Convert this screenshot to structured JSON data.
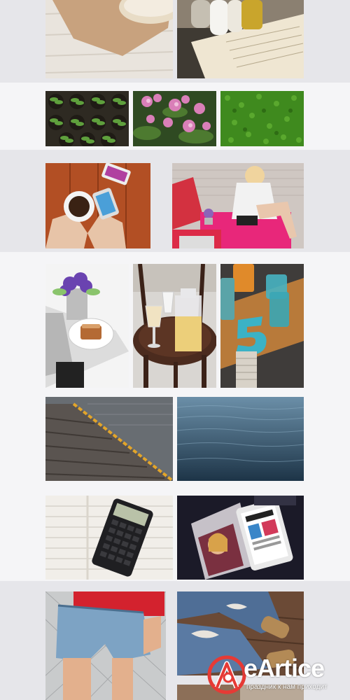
{
  "colors": {
    "page_background": "#ececef",
    "band_light": "#f5f5f7",
    "band_dark": "#e6e6ea",
    "watermark_red": "#e63a35"
  },
  "gallery": {
    "rows": [
      {
        "name": "row-1",
        "photos": [
          {
            "icon": "bread-on-paper-photo"
          },
          {
            "icon": "table-salt-pepper-menu-photo"
          }
        ]
      },
      {
        "name": "row-2",
        "photos": [
          {
            "icon": "seedlings-photo"
          },
          {
            "icon": "pink-flowers-photo"
          },
          {
            "icon": "green-grass-photo"
          }
        ]
      },
      {
        "name": "row-3",
        "photos": [
          {
            "icon": "coffee-cup-hands-photo"
          },
          {
            "icon": "woman-reading-sofa-photo"
          }
        ]
      },
      {
        "name": "row-4",
        "photos": [
          {
            "icon": "violets-cake-magazine-photo"
          },
          {
            "icon": "chair-glasses-jar-photo"
          },
          {
            "icon": "number-five-jars-photo"
          }
        ]
      },
      {
        "name": "row-5",
        "photos": [
          {
            "icon": "pier-water-photo"
          },
          {
            "icon": "blue-water-photo"
          }
        ]
      },
      {
        "name": "row-6",
        "photos": [
          {
            "icon": "calculator-paper-photo"
          },
          {
            "icon": "tablet-magazine-photo"
          }
        ]
      },
      {
        "name": "row-7",
        "photos": [
          {
            "icon": "denim-shorts-photo"
          },
          {
            "icon": "ripped-jeans-photo"
          }
        ]
      }
    ]
  },
  "watermark": {
    "brand": "eArtice",
    "tagline": "праздник к нам приходит"
  }
}
